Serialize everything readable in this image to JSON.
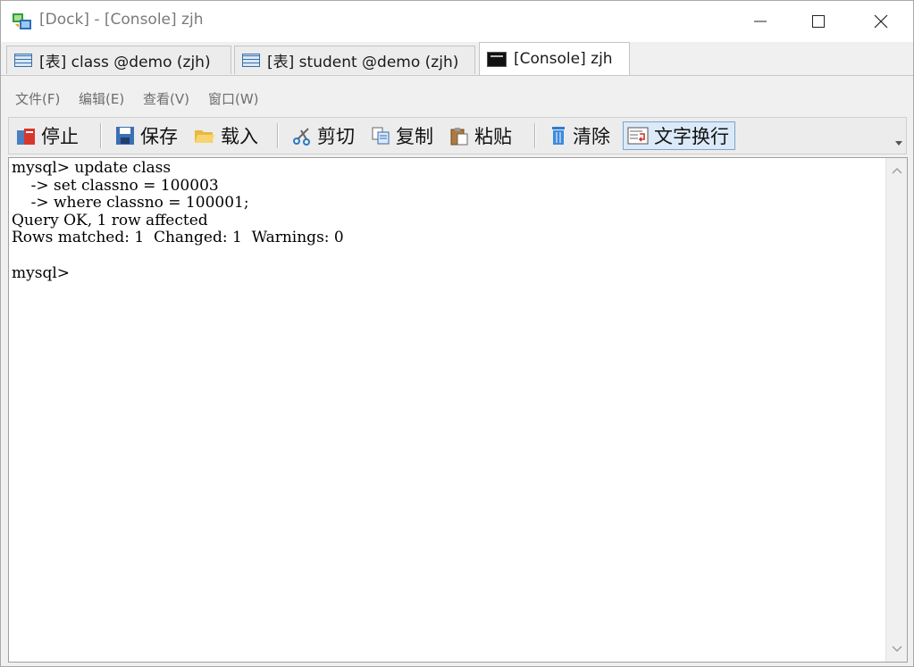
{
  "window": {
    "title": "[Dock] - [Console] zjh",
    "controls": [
      "minimize",
      "maximize",
      "close"
    ]
  },
  "tabs": [
    {
      "label": "[表] class @demo (zjh)",
      "icon": "table-icon",
      "active": false
    },
    {
      "label": "[表] student @demo (zjh)",
      "icon": "table-icon",
      "active": false
    },
    {
      "label": "[Console] zjh",
      "icon": "console-icon",
      "active": true
    }
  ],
  "menu": {
    "file": "文件(F)",
    "edit": "编辑(E)",
    "view": "查看(V)",
    "window": "窗口(W)"
  },
  "toolbar": {
    "stop": "停止",
    "save": "保存",
    "load": "载入",
    "cut": "剪切",
    "copy": "复制",
    "paste": "粘贴",
    "clear": "清除",
    "wrap": "文字换行"
  },
  "console": {
    "lines": [
      "mysql> update class",
      "    -> set classno = 100003",
      "    -> where classno = 100001;",
      "Query OK, 1 row affected",
      "Rows matched: 1  Changed: 1  Warnings: 0",
      "",
      "mysql>"
    ]
  },
  "colors": {
    "accent_active_button": "#dbe9f8",
    "window_bg": "#f0f0f0",
    "console_bg": "#ffffff"
  }
}
